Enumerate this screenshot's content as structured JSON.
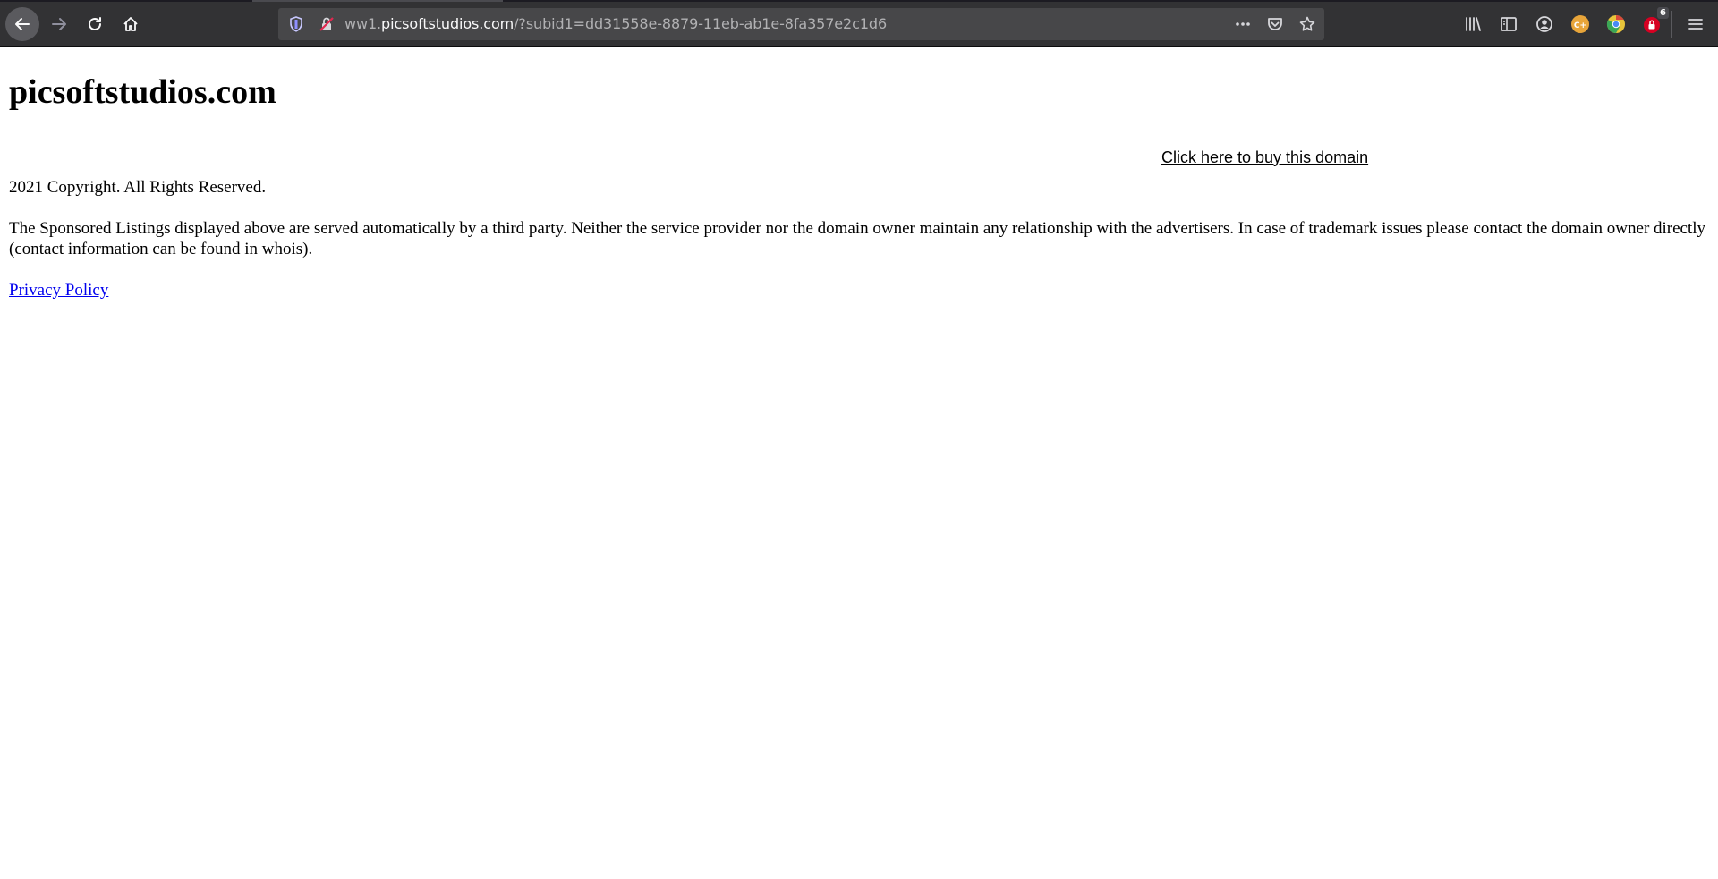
{
  "browser": {
    "url_prefix": "ww1.",
    "url_host": "picsoftstudios.com",
    "url_path": "/?subid1=dd31558e-8879-11eb-ab1e-8fa357e2c1d6",
    "extension_badge": "6",
    "extension_avatar_label": "C+"
  },
  "page": {
    "title": "picsoftstudios.com",
    "buy_link": "Click here to buy this domain",
    "copyright": "2021 Copyright. All Rights Reserved.",
    "disclaimer": "The Sponsored Listings displayed above are served automatically by a third party. Neither the service provider nor the domain owner maintain any relationship with the advertisers. In case of trademark issues please contact the domain owner directly (contact information can be found in whois).",
    "privacy_link": "Privacy Policy"
  },
  "colors": {
    "toolbar": "#323234",
    "urlbar": "#474749",
    "link": "#0000ee"
  }
}
